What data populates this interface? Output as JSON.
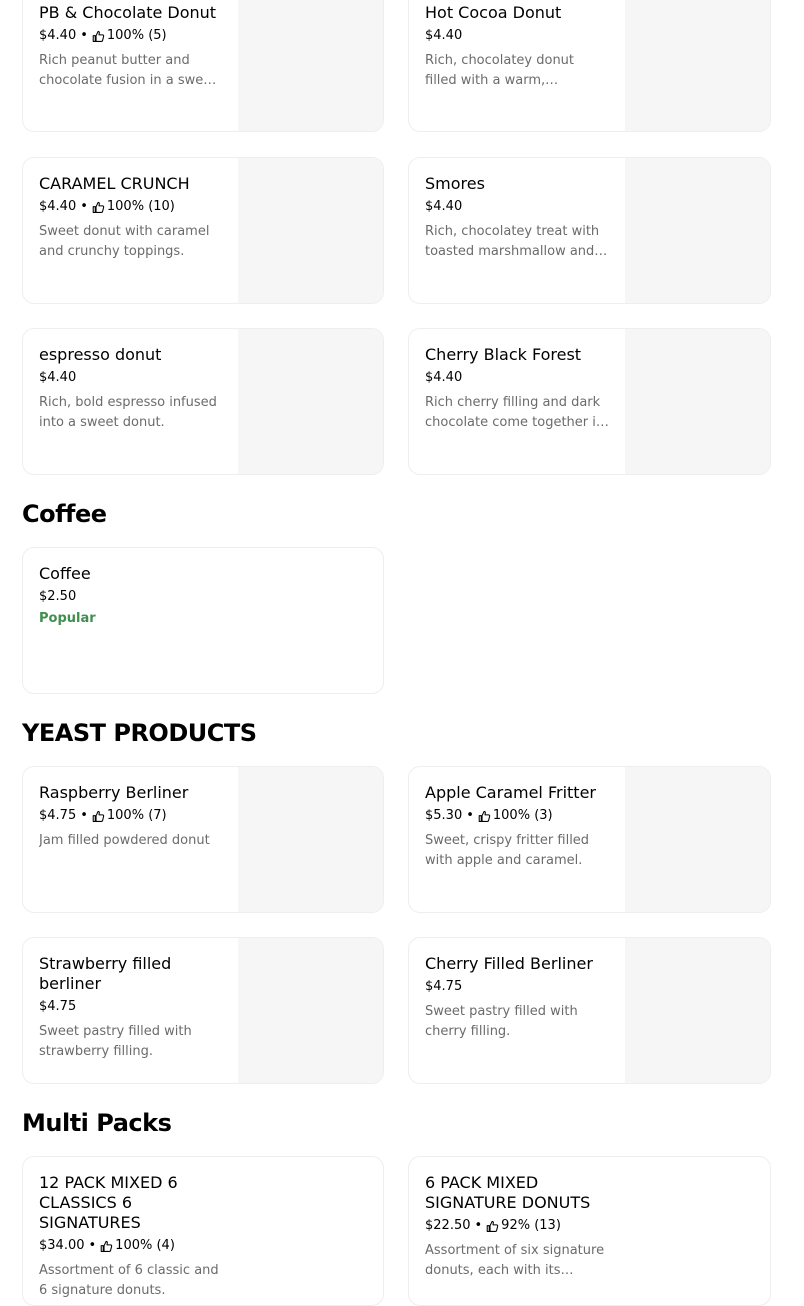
{
  "sections": [
    {
      "title": "Coffee"
    },
    {
      "title": "YEAST PRODUCTS"
    },
    {
      "title": "Multi Packs"
    }
  ],
  "items": [
    {
      "name": "PB & Chocolate Donut",
      "price": "$4.40",
      "rating": "100% (5)",
      "description": "Rich peanut butter and chocolate fusion in a sweet donut."
    },
    {
      "name": "Hot Cocoa Donut",
      "price": "$4.40",
      "description": "Rich, chocolatey donut filled with a warm, comforting hot cocoa flavor."
    },
    {
      "name": "CARAMEL CRUNCH",
      "price": "$4.40",
      "rating": "100% (10)",
      "description": "Sweet donut with caramel and crunchy toppings."
    },
    {
      "name": "Smores",
      "price": "$4.40",
      "description": "Rich, chocolatey treat with toasted marshmallow and graham cracker."
    },
    {
      "name": "espresso donut",
      "price": "$4.40",
      "description": "Rich, bold espresso infused into a sweet donut."
    },
    {
      "name": "Cherry Black Forest",
      "price": "$4.40",
      "description": "Rich cherry filling and dark chocolate come together in a sweet donut."
    },
    {
      "name": "Coffee",
      "price": "$2.50",
      "badge": "Popular"
    },
    {
      "name": "Raspberry Berliner",
      "price": "$4.75",
      "rating": "100% (7)",
      "description": "Jam filled powdered donut"
    },
    {
      "name": "Apple Caramel Fritter",
      "price": "$5.30",
      "rating": "100% (3)",
      "description": "Sweet, crispy fritter filled with apple and caramel."
    },
    {
      "name": "Strawberry filled berliner",
      "price": "$4.75",
      "description": "Sweet pastry filled with strawberry filling."
    },
    {
      "name": "Cherry Filled Berliner",
      "price": "$4.75",
      "description": "Sweet pastry filled with cherry filling."
    },
    {
      "name": "12 PACK MIXED 6 CLASSICS 6 SIGNATURES",
      "price": "$34.00",
      "rating": "100% (4)",
      "description": "Assortment of 6 classic and 6 signature donuts."
    },
    {
      "name": "6 PACK MIXED SIGNATURE DONUTS",
      "price": "$22.50",
      "rating": "92% (13)",
      "description": "Assortment of six signature donuts, each with its unique flavor."
    }
  ],
  "colors": {
    "popular": "#3f8f4f",
    "description": "#6b6b6b",
    "border": "#eeeeee",
    "image_placeholder": "#f6f6f6"
  },
  "icons": {
    "rating": "thumbs-up-icon"
  }
}
